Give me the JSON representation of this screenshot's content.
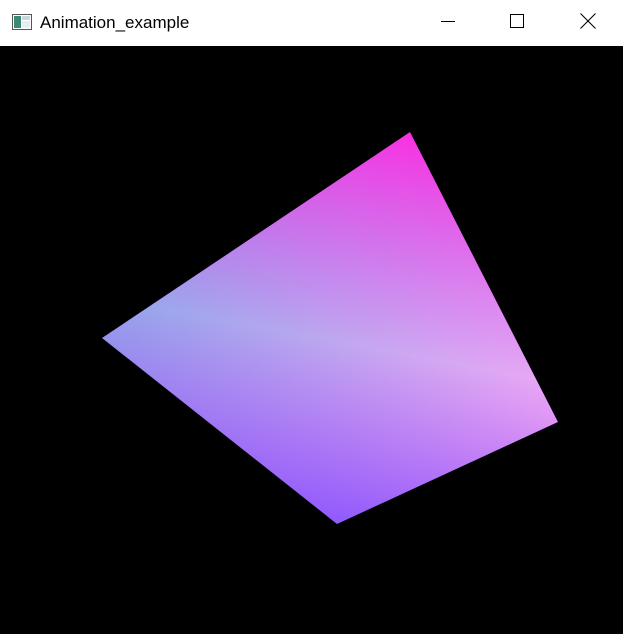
{
  "window": {
    "title": "Animation_example",
    "controls": {
      "minimize": "minimize",
      "maximize": "maximize",
      "close": "close"
    }
  },
  "icons": {
    "app": "app-window-icon",
    "minimize": "minimize-icon",
    "maximize": "maximize-icon",
    "close": "close-icon"
  },
  "scene": {
    "background_color": "#000000",
    "quad_vertex_colors": {
      "top": "#ff1ee0",
      "left": "#7fd6e8",
      "bottom": "#8a4dff",
      "right": "#ffd9f6"
    }
  }
}
